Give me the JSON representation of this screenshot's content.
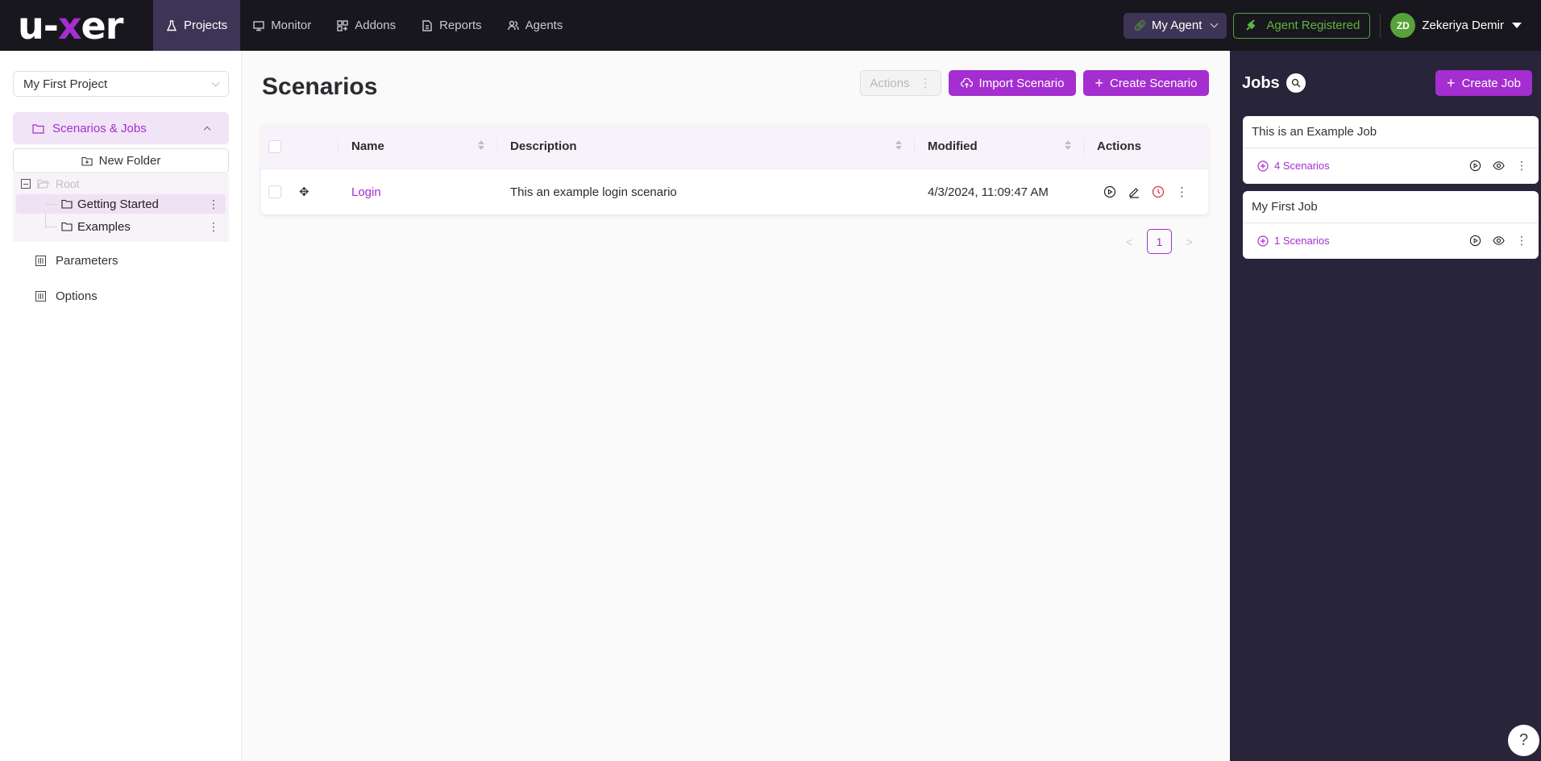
{
  "brand": {
    "logo_left": "u-",
    "logo_x": "x",
    "logo_right": "er",
    "accent": "#a42ecf"
  },
  "nav": {
    "items": [
      {
        "label": "Projects",
        "icon": "flask-icon",
        "active": true
      },
      {
        "label": "Monitor",
        "icon": "monitor-icon",
        "active": false
      },
      {
        "label": "Addons",
        "icon": "addons-icon",
        "active": false
      },
      {
        "label": "Reports",
        "icon": "report-icon",
        "active": false
      },
      {
        "label": "Agents",
        "icon": "agents-icon",
        "active": false
      }
    ]
  },
  "header_right": {
    "agent_select": "My Agent",
    "agent_status": "Agent Registered",
    "user_initials": "ZD",
    "user_name": "Zekeriya Demir"
  },
  "sidebar": {
    "project": "My First Project",
    "section": "Scenarios & Jobs",
    "new_folder": "New Folder",
    "tree": {
      "root": "Root",
      "folders": [
        {
          "label": "Getting Started",
          "selected": true
        },
        {
          "label": "Examples",
          "selected": false
        }
      ]
    },
    "menu": [
      {
        "label": "Parameters"
      },
      {
        "label": "Options"
      }
    ]
  },
  "main": {
    "title": "Scenarios",
    "actions_label": "Actions",
    "import_label": "Import Scenario",
    "create_label": "Create Scenario",
    "table": {
      "columns": [
        "Name",
        "Description",
        "Modified",
        "Actions"
      ],
      "rows": [
        {
          "name": "Login",
          "description": "This an example login scenario",
          "modified": "4/3/2024, 11:09:47 AM"
        }
      ]
    },
    "pagination": {
      "current": "1",
      "prev": "<",
      "next": ">"
    }
  },
  "jobs": {
    "title": "Jobs",
    "create_label": "Create Job",
    "items": [
      {
        "name": "This is an Example Job",
        "scenarios": "4 Scenarios"
      },
      {
        "name": "My First Job",
        "scenarios": "1 Scenarios"
      }
    ]
  },
  "help": {
    "label": "?"
  }
}
